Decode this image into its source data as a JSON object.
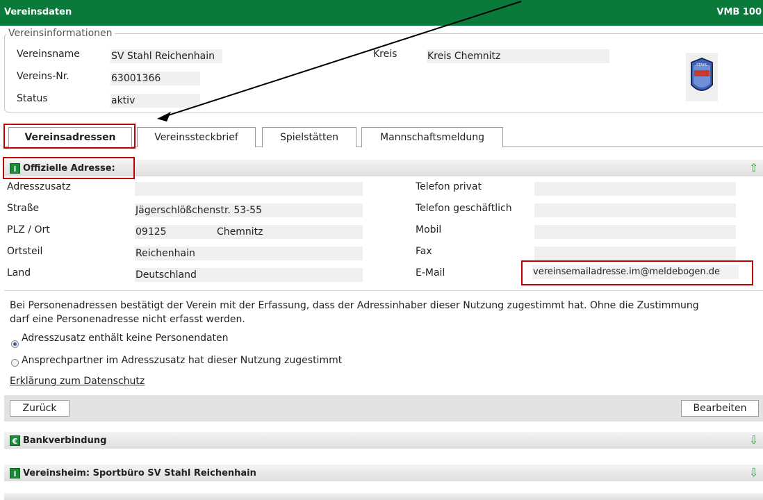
{
  "title_left": "Vereinsdaten",
  "title_right": "VMB 100",
  "info": {
    "legend": "Vereinsinformationen",
    "name_label": "Vereinsname",
    "name_value": "SV Stahl Reichenhain",
    "kreis_label": "Kreis",
    "kreis_value": "Kreis Chemnitz",
    "nr_label": "Vereins-Nr.",
    "nr_value": "63001366",
    "status_label": "Status",
    "status_value": "aktiv",
    "logo_text": "STAHL"
  },
  "tabs": [
    "Vereinsadressen",
    "Vereinssteckbrief",
    "Spielstätten",
    "Mannschaftsmeldung"
  ],
  "address": {
    "title": "Offizielle Adresse:",
    "left": [
      {
        "label": "Adresszusatz",
        "value": ""
      },
      {
        "label": "Straße",
        "value": "Jägerschlößchenstr. 53-55"
      },
      {
        "label": "PLZ / Ort",
        "value": "09125",
        "value2": "Chemnitz"
      },
      {
        "label": "Ortsteil",
        "value": "Reichenhain"
      },
      {
        "label": "Land",
        "value": "Deutschland"
      }
    ],
    "right": [
      {
        "label": "Telefon privat",
        "value": ""
      },
      {
        "label": "Telefon geschäftlich",
        "value": ""
      },
      {
        "label": "Mobil",
        "value": ""
      },
      {
        "label": "Fax",
        "value": ""
      },
      {
        "label": "E-Mail",
        "value": "vereinsemailadresse.im@meldebogen.de"
      }
    ]
  },
  "consent_text_1": "Bei Personenadressen bestätigt der Verein mit der Erfassung, dass der Adressinhaber dieser Nutzung zugestimmt hat. Ohne die Zustimmung",
  "consent_text_2": "darf eine Personenadresse nicht erfasst werden.",
  "radio1": "Adresszusatz enthält keine Personendaten",
  "radio2": "Ansprechpartner im Adresszusatz hat dieser Nutzung zugestimmt",
  "privacy_link": "Erklärung zum Datenschutz",
  "back_button": "Zurück",
  "edit_button": "Bearbeiten",
  "sections": [
    {
      "icon": "€",
      "title": "Bankverbindung"
    },
    {
      "icon": "i",
      "title": "Vereinsheim: Sportbüro SV Stahl Reichenhain"
    }
  ],
  "address_icon": "i",
  "colors": {
    "header_green": "#0a7a3a",
    "highlight_red": "#c00000",
    "icon_green": "#1d8a3a"
  }
}
